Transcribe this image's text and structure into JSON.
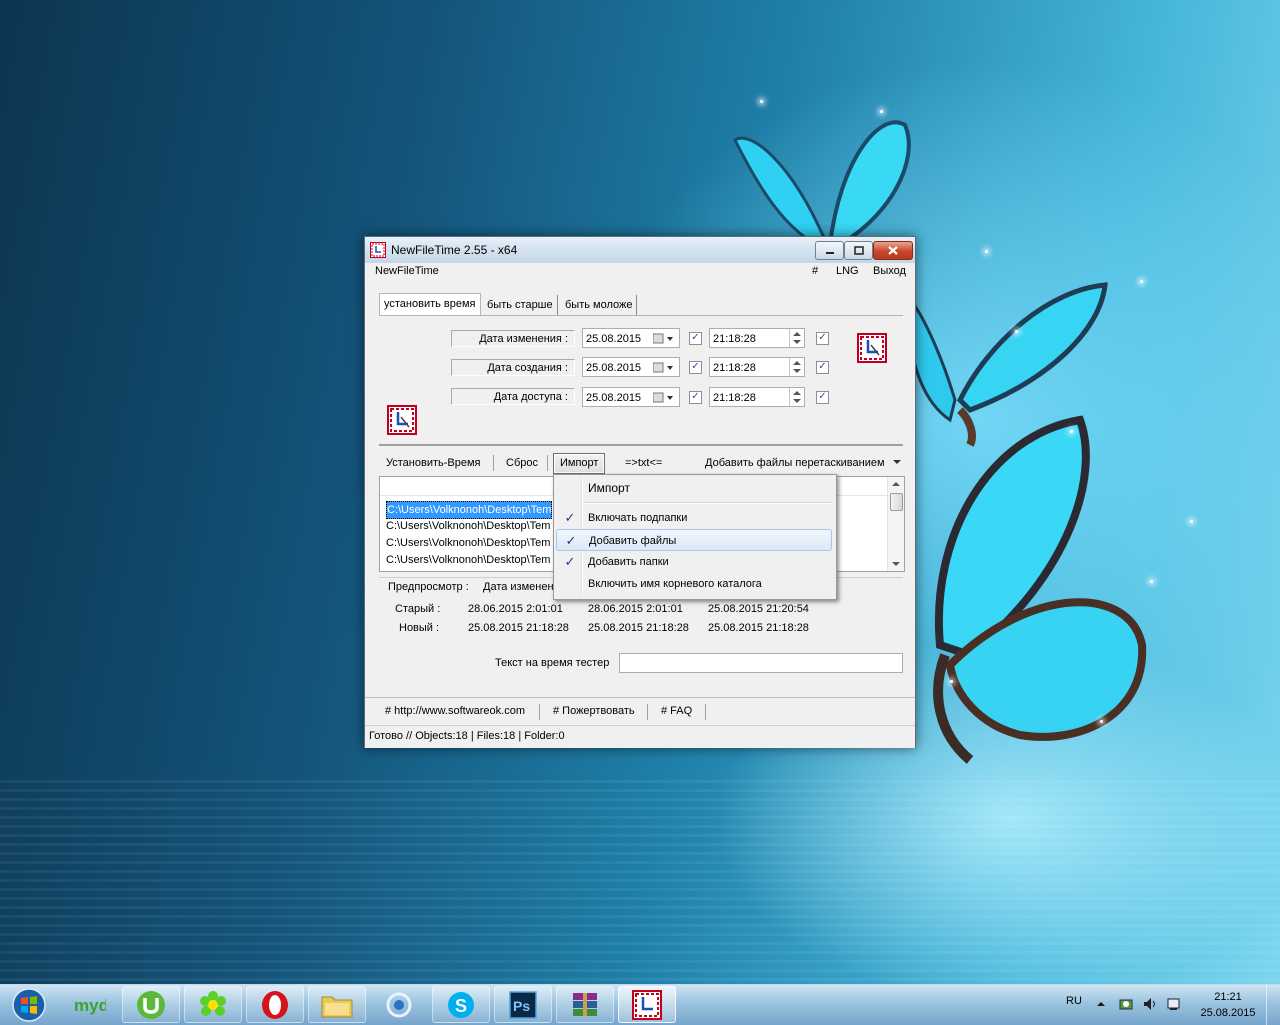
{
  "window": {
    "title": "NewFileTime 2.55 - x64",
    "menu": {
      "app": "NewFileTime",
      "hash": "#",
      "lng": "LNG",
      "exit": "Выход"
    }
  },
  "tabs": [
    "установить время",
    "быть старше",
    "быть моложе"
  ],
  "date_rows": [
    {
      "label": "Дата изменения :",
      "date": "25.08.2015",
      "time": "21:18:28"
    },
    {
      "label": "Дата создания :",
      "date": "25.08.2015",
      "time": "21:18:28"
    },
    {
      "label": "Дата доступа :",
      "date": "25.08.2015",
      "time": "21:18:28"
    }
  ],
  "actions": {
    "set_time": "Установить-Время",
    "reset": "Сброс",
    "import": "Импорт",
    "txt": "=>txt<=",
    "drag_drop": "Добавить файлы перетаскиванием"
  },
  "file_list": [
    "C:\\Users\\Volknonoh\\Desktop\\Tem",
    "C:\\Users\\Volknonoh\\Desktop\\Tem",
    "C:\\Users\\Volknonoh\\Desktop\\Tem",
    "C:\\Users\\Volknonoh\\Desktop\\Tem"
  ],
  "preview": {
    "header_label": "Предпросмотр :",
    "header_col1": "Дата изменен",
    "old_label": "Старый :",
    "new_label": "Новый :",
    "old": [
      "28.06.2015 2:01:01",
      "28.06.2015 2:01:01",
      "25.08.2015 21:20:54"
    ],
    "new": [
      "25.08.2015 21:18:28",
      "25.08.2015 21:18:28",
      "25.08.2015 21:18:28"
    ]
  },
  "tester_label": "Текст на время тестер",
  "links": {
    "site": "# http://www.softwareok.com",
    "donate": "# Пожертвовать",
    "faq": "# FAQ"
  },
  "status": "Готово // Objects:18 | Files:18 | Folder:0",
  "context_menu": {
    "header": "Импорт",
    "items": [
      {
        "label": "Включать подпапки",
        "checked": true
      },
      {
        "label": "Добавить файлы",
        "checked": true
      },
      {
        "label": "Добавить папки",
        "checked": true
      },
      {
        "label": "Включить имя корневого каталога",
        "checked": false
      }
    ]
  },
  "taskbar": {
    "items": [
      "start-orb",
      "mydefrag",
      "utorrent",
      "icq",
      "opera",
      "explorer",
      "qip",
      "skype",
      "photoshop",
      "winrar",
      "newfiletime"
    ],
    "tray_lang": "RU",
    "time": "21:21",
    "date": "25.08.2015"
  },
  "colors": {
    "accent": "#3399ff",
    "selection": "#3399ff",
    "desktop": "#1f7fa8"
  }
}
